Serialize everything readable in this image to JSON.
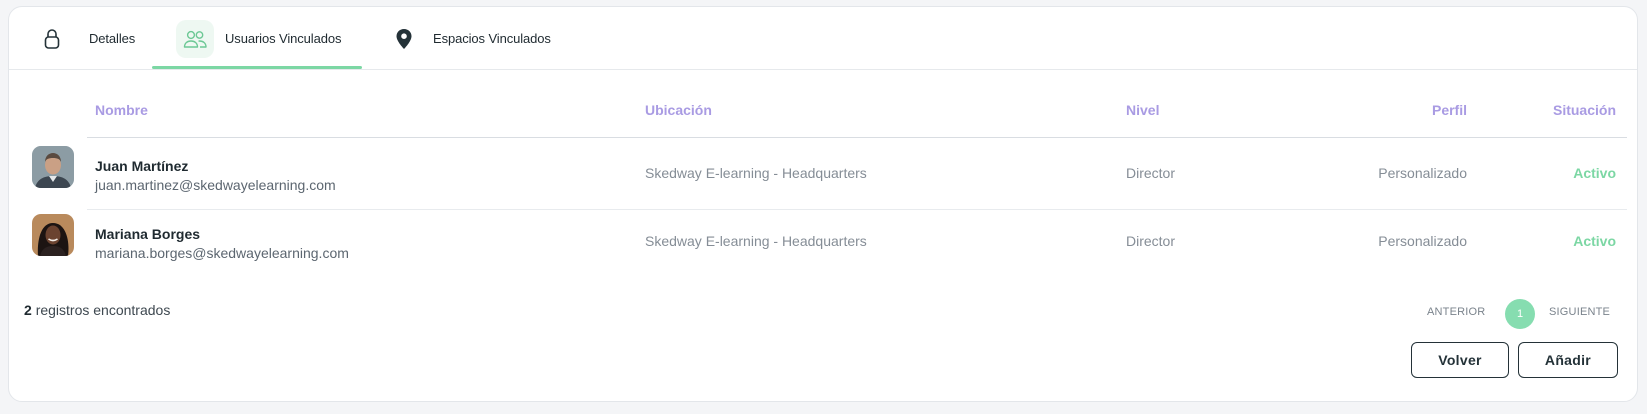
{
  "tabs": [
    {
      "label": "Detalles",
      "icon": "lock-icon"
    },
    {
      "label": "Usuarios Vinculados",
      "icon": "users-icon",
      "active": true
    },
    {
      "label": "Espacios Vinculados",
      "icon": "map-pin-icon"
    }
  ],
  "table": {
    "headers": {
      "nombre": "Nombre",
      "ubicacion": "Ubicación",
      "nivel": "Nivel",
      "perfil": "Perfil",
      "situacion": "Situación"
    },
    "rows": [
      {
        "name": "Juan Martínez",
        "email": "juan.martinez@skedwayelearning.com",
        "location": "Skedway E-learning - Headquarters",
        "level": "Director",
        "profile": "Personalizado",
        "status": "Activo"
      },
      {
        "name": "Mariana Borges",
        "email": "mariana.borges@skedwayelearning.com",
        "location": "Skedway E-learning - Headquarters",
        "level": "Director",
        "profile": "Personalizado",
        "status": "Activo"
      }
    ]
  },
  "footer": {
    "count": "2",
    "count_text": "registros encontrados"
  },
  "pagination": {
    "prev": "ANTERIOR",
    "current": "1",
    "next": "SIGUIENTE"
  },
  "actions": {
    "back": "Volver",
    "add": "Añadir"
  },
  "colors": {
    "accent_green": "#7cd7a4",
    "header_purple": "#a99be3",
    "dark": "#243238"
  }
}
